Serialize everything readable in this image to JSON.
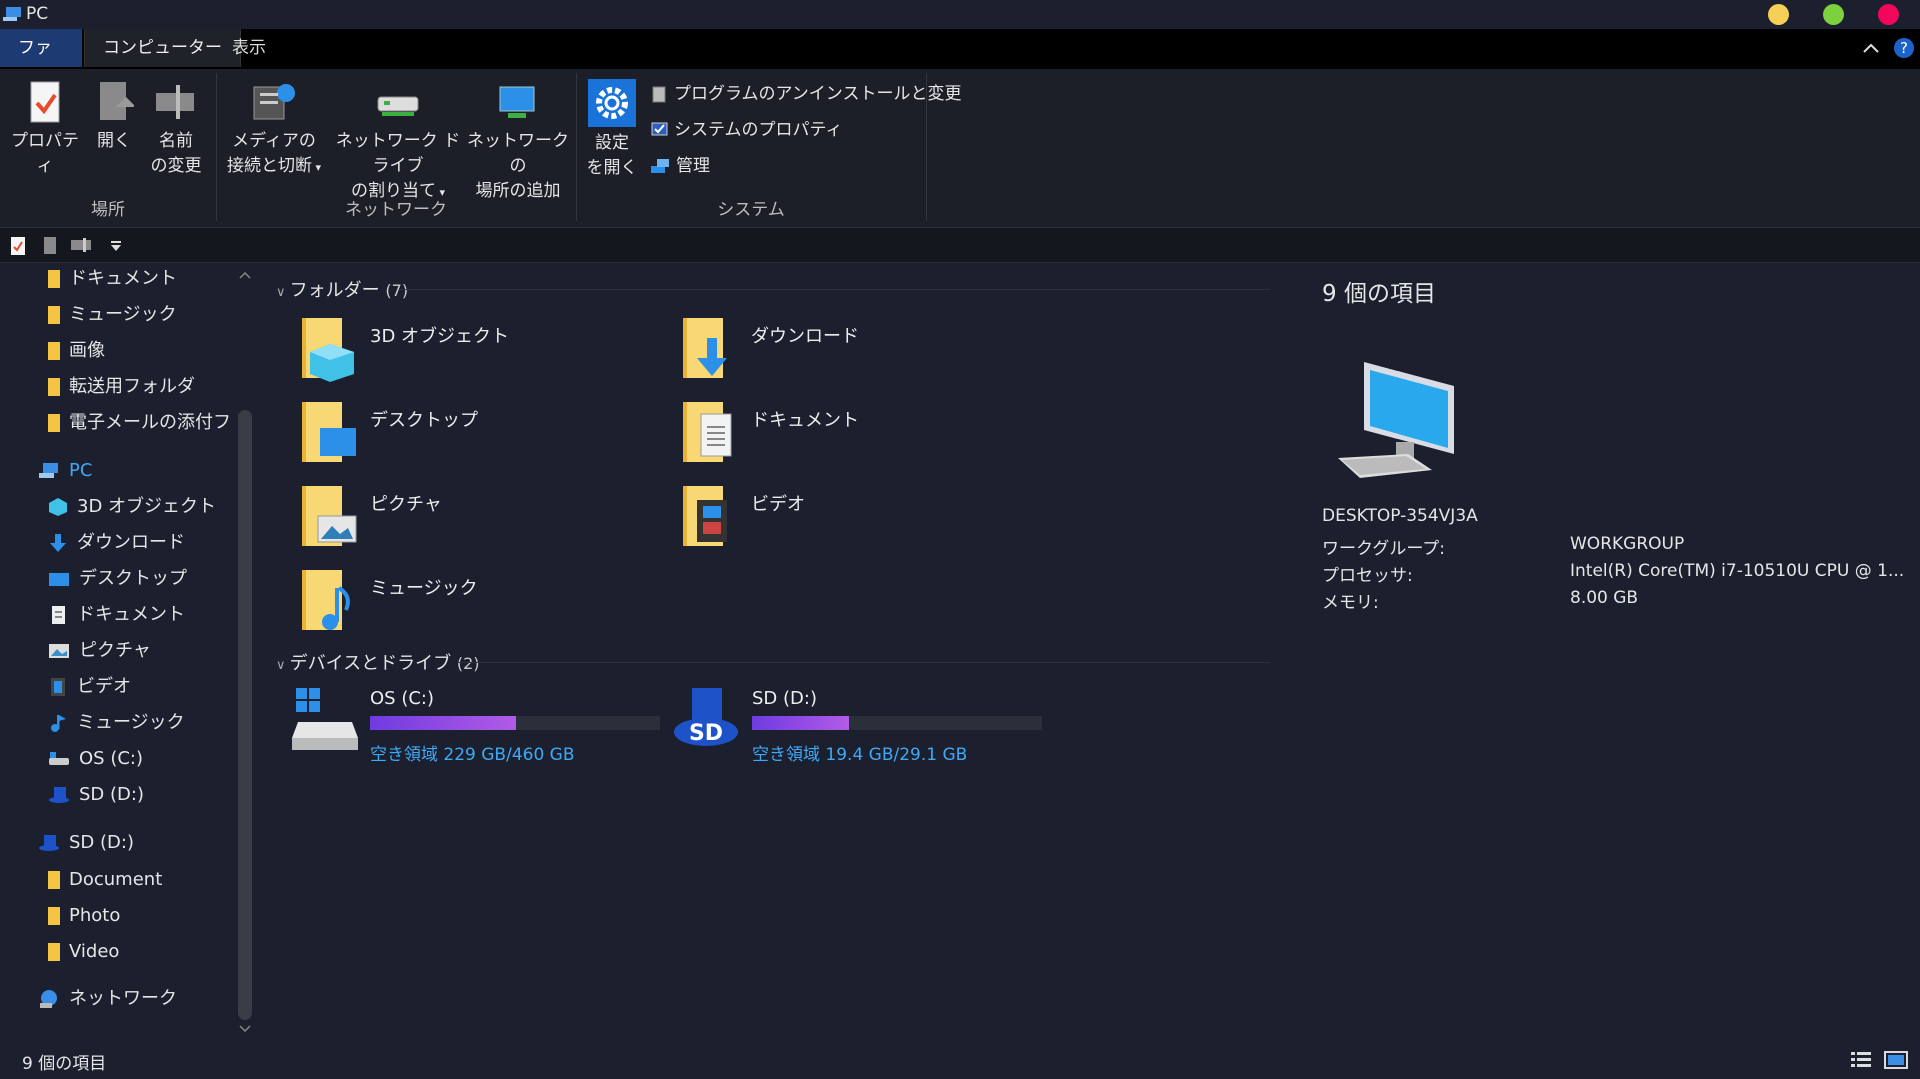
{
  "window": {
    "title": "PC"
  },
  "colors": {
    "accent": "#1e3a73",
    "link": "#3fa9f5",
    "dot_yellow": "#f6cf57",
    "dot_green": "#7cd13c",
    "dot_red": "#f2075a"
  },
  "tabs": {
    "file": "ファイル",
    "computer": "コンピューター",
    "view": "表示"
  },
  "ribbon": {
    "location": {
      "label": "場所",
      "properties": "プロパティ",
      "open": "開く",
      "rename_1": "名前",
      "rename_2": "の変更"
    },
    "network": {
      "label": "ネットワーク",
      "media_1": "メディアの",
      "media_2": "接続と切断",
      "map_1": "ネットワーク ドライブ",
      "map_2": "の割り当て",
      "add_1": "ネットワークの",
      "add_2": "場所の追加"
    },
    "system": {
      "label": "システム",
      "settings_1": "設定",
      "settings_2": "を開く",
      "uninstall": "プログラムのアンインストールと変更",
      "sysprops": "システムのプロパティ",
      "manage": "管理"
    }
  },
  "sidebar": {
    "quick": [
      "ドキュメント",
      "ミュージック",
      "画像",
      "転送用フォルダ",
      "電子メールの添付ファイル"
    ],
    "pc": "PC",
    "pc_items": [
      "3D オブジェクト",
      "ダウンロード",
      "デスクトップ",
      "ドキュメント",
      "ピクチャ",
      "ビデオ",
      "ミュージック",
      "OS (C:)",
      "SD (D:)"
    ],
    "sd": "SD (D:)",
    "sd_items": [
      "Document",
      "Photo",
      "Video"
    ],
    "network": "ネットワーク"
  },
  "main": {
    "folders_header": "フォルダー",
    "folders_count": "(7)",
    "folders": [
      "3D オブジェクト",
      "ダウンロード",
      "デスクトップ",
      "ドキュメント",
      "ピクチャ",
      "ビデオ",
      "ミュージック"
    ],
    "drives_header": "デバイスとドライブ",
    "drives_count": "(2)",
    "drives": [
      {
        "name": "OS (C:)",
        "free_text": "空き領域 229 GB/460 GB",
        "used_fraction": 0.502
      },
      {
        "name": "SD (D:)",
        "free_text": "空き領域 19.4 GB/29.1 GB",
        "used_fraction": 0.333
      }
    ]
  },
  "details": {
    "count": "9 個の項目",
    "computer_name": "DESKTOP-354VJ3A",
    "workgroup_label": "ワークグループ:",
    "workgroup_value": "WORKGROUP",
    "processor_label": "プロセッサ:",
    "processor_value": "Intel(R) Core(TM) i7-10510U CPU @ 1...",
    "memory_label": "メモリ:",
    "memory_value": "8.00 GB"
  },
  "status": {
    "count": "9 個の項目"
  }
}
